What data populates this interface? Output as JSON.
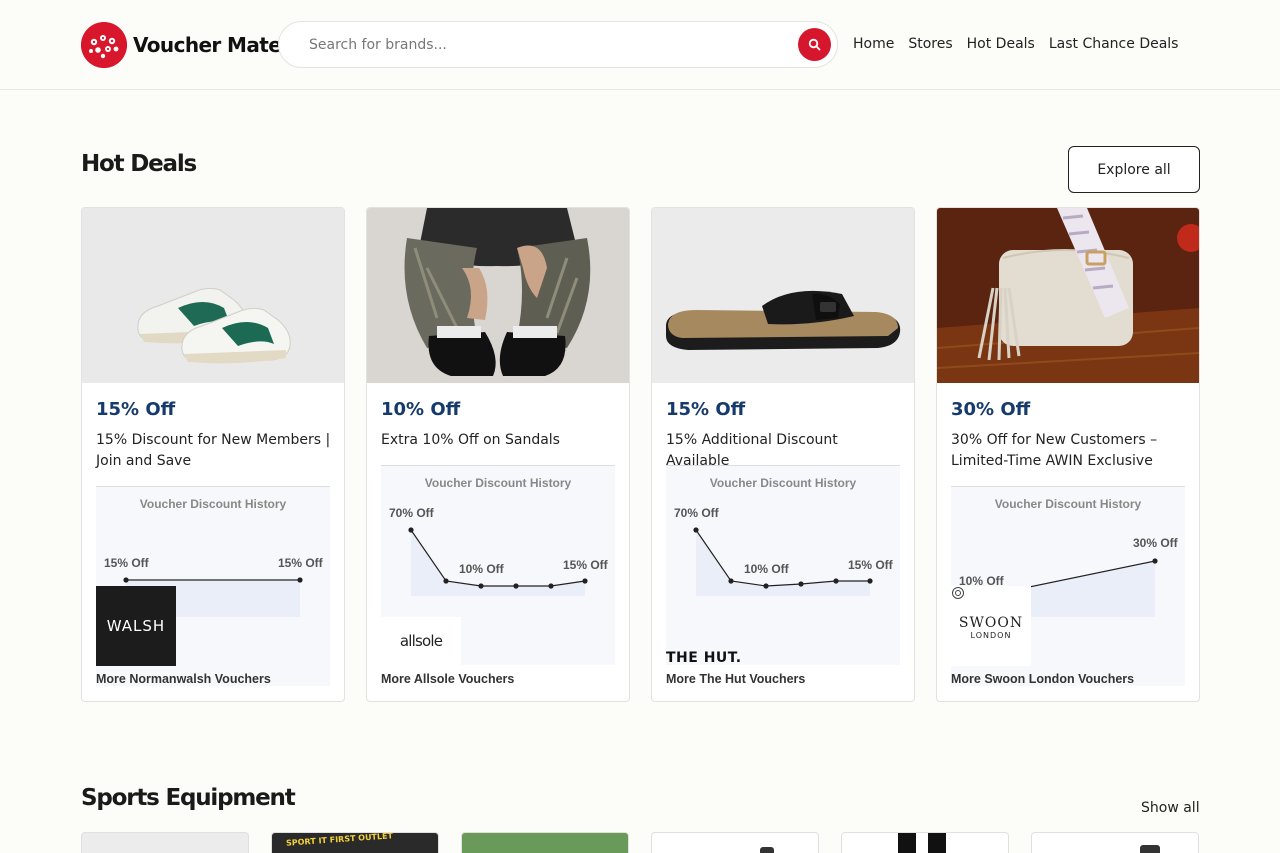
{
  "brand": {
    "name": "Voucher Mate",
    "accent": "#d5162c"
  },
  "search": {
    "placeholder": "Search for brands...",
    "value": "",
    "icon": "search-icon"
  },
  "nav": [
    "Home",
    "Stores",
    "Hot Deals",
    "Last Chance Deals"
  ],
  "hot_deals": {
    "title": "Hot Deals",
    "explore_label": "Explore all",
    "cards": [
      {
        "discount": "15% Off",
        "description": "15% Discount for New Members | Join and Save",
        "history_title": "Voucher Discount History",
        "history_points": [
          15,
          15
        ],
        "labels": [
          "15% Off",
          "15% Off"
        ],
        "brand_logo_text": "WALSH",
        "more_link": "More Normanwalsh Vouchers"
      },
      {
        "discount": "10% Off",
        "description": "Extra 10% Off on Sandals",
        "history_title": "Voucher Discount History",
        "history_points": [
          70,
          15,
          10,
          10,
          10,
          15
        ],
        "labels": [
          "70% Off",
          "10% Off",
          "15% Off"
        ],
        "brand_logo_text": "allsole",
        "more_link": "More Allsole Vouchers"
      },
      {
        "discount": "15% Off",
        "description": "15% Additional Discount Available",
        "history_title": "Voucher Discount History",
        "history_points": [
          70,
          15,
          10,
          10,
          15,
          15
        ],
        "labels": [
          "70% Off",
          "10% Off",
          "15% Off"
        ],
        "brand_logo_text": "THE HUT.",
        "more_link": "More The Hut Vouchers"
      },
      {
        "discount": "30% Off",
        "description": "30% Off for New Customers – Limited-Time AWIN Exclusive",
        "history_title": "Voucher Discount History",
        "history_points": [
          10,
          30
        ],
        "labels": [
          "10% Off",
          "30% Off"
        ],
        "brand_logo_text": "SWOON",
        "brand_logo_subtext": "LONDON",
        "more_link": "More Swoon London Vouchers"
      }
    ]
  },
  "sports": {
    "title": "Sports Equipment",
    "show_all_label": "Show all",
    "tile_sign": "SPORT IT FIRST OUTLET"
  }
}
